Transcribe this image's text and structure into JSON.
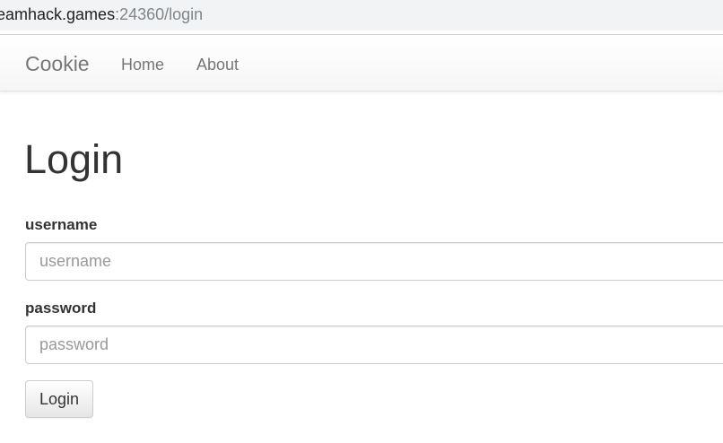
{
  "browser": {
    "url_host": "teamhack.games",
    "url_rest": ":24360/login"
  },
  "navbar": {
    "brand": "Cookie",
    "links": [
      "Home",
      "About"
    ]
  },
  "main": {
    "title": "Login",
    "username": {
      "label": "username",
      "placeholder": "username",
      "value": ""
    },
    "password": {
      "label": "password",
      "placeholder": "password",
      "value": ""
    },
    "submit_label": "Login"
  }
}
